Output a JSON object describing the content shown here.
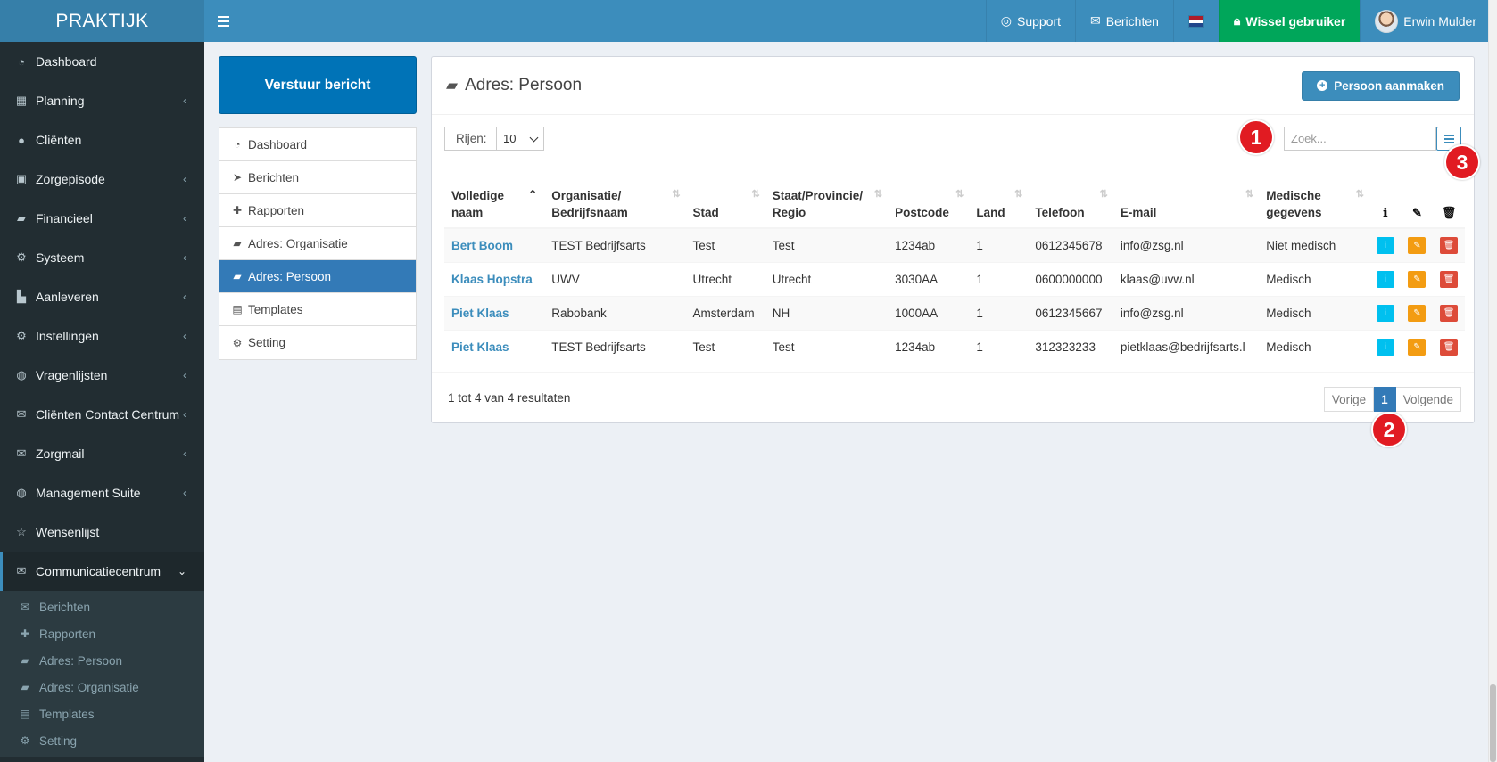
{
  "app": {
    "logo": "PRAKTIJK"
  },
  "header": {
    "support": "Support",
    "messages": "Berichten",
    "switch_user": "Wissel gebruiker",
    "user_name": "Erwin Mulder",
    "flag_colors": [
      "#ae1c28",
      "#ffffff",
      "#21468b"
    ]
  },
  "sidebar": {
    "items": [
      {
        "label": "Dashboard",
        "icon": "dashboard-icon",
        "glyph": "◔"
      },
      {
        "label": "Planning",
        "icon": "calendar-icon",
        "glyph": "▦"
      },
      {
        "label": "Cliënten",
        "icon": "user-icon",
        "glyph": "●"
      },
      {
        "label": "Zorgepisode",
        "icon": "briefcase-icon",
        "glyph": "▣"
      },
      {
        "label": "Financieel",
        "icon": "book-icon",
        "glyph": "▰"
      },
      {
        "label": "Systeem",
        "icon": "cogs-icon",
        "glyph": "⚙"
      },
      {
        "label": "Aanleveren",
        "icon": "truck-icon",
        "glyph": "▙"
      },
      {
        "label": "Instellingen",
        "icon": "gear-icon",
        "glyph": "⚙"
      },
      {
        "label": "Vragenlijsten",
        "icon": "globe-icon",
        "glyph": "◍"
      },
      {
        "label": "Cliënten Contact Centrum",
        "icon": "envelope-icon",
        "glyph": "✉"
      },
      {
        "label": "Zorgmail",
        "icon": "envelope-icon",
        "glyph": "✉"
      },
      {
        "label": "Management Suite",
        "icon": "globe-icon",
        "glyph": "◍"
      },
      {
        "label": "Wensenlijst",
        "icon": "star-icon",
        "glyph": "☆"
      },
      {
        "label": "Communicatiecentrum",
        "icon": "envelope-icon",
        "glyph": "✉"
      }
    ],
    "subitems": [
      {
        "label": "Berichten",
        "icon": "envelope-icon",
        "glyph": "✉"
      },
      {
        "label": "Rapporten",
        "icon": "puzzle-icon",
        "glyph": "✚"
      },
      {
        "label": "Adres: Persoon",
        "icon": "book-icon",
        "glyph": "▰"
      },
      {
        "label": "Adres: Organisatie",
        "icon": "book-icon",
        "glyph": "▰"
      },
      {
        "label": "Templates",
        "icon": "cubes-icon",
        "glyph": "▤"
      },
      {
        "label": "Setting",
        "icon": "cogs-icon",
        "glyph": "⚙"
      }
    ]
  },
  "side_panel": {
    "send_button": "Verstuur bericht",
    "items": [
      {
        "label": "Dashboard",
        "icon": "dashboard-icon",
        "glyph": "◔"
      },
      {
        "label": "Berichten",
        "icon": "paper-plane-icon",
        "glyph": "➤"
      },
      {
        "label": "Rapporten",
        "icon": "puzzle-icon",
        "glyph": "✚"
      },
      {
        "label": "Adres: Organisatie",
        "icon": "book-icon",
        "glyph": "▰"
      },
      {
        "label": "Adres: Persoon",
        "icon": "book-icon",
        "glyph": "▰"
      },
      {
        "label": "Templates",
        "icon": "cubes-icon",
        "glyph": "▤"
      },
      {
        "label": "Setting",
        "icon": "cogs-icon",
        "glyph": "⚙"
      }
    ]
  },
  "content": {
    "title": "Adres: Persoon",
    "create_button": "Persoon aanmaken",
    "rows_label": "Rijen:",
    "rows_value": "10",
    "search_placeholder": "Zoek...",
    "columns": [
      "Volledige naam",
      "Organisatie/ Bedrijfsnaam",
      "Stad",
      "Staat/Provincie/ Regio",
      "Postcode",
      "Land",
      "Telefoon",
      "E-mail",
      "Medische gegevens"
    ],
    "rows": [
      [
        "Bert Boom",
        "TEST Bedrijfsarts",
        "Test",
        "Test",
        "1234ab",
        "1",
        "0612345678",
        "info@zsg.nl",
        "Niet medisch"
      ],
      [
        "Klaas Hopstra",
        "UWV",
        "Utrecht",
        "Utrecht",
        "3030AA",
        "1",
        "0600000000",
        "klaas@uvw.nl",
        "Medisch"
      ],
      [
        "Piet Klaas",
        "Rabobank",
        "Amsterdam",
        "NH",
        "1000AA",
        "1",
        "0612345667",
        "info@zsg.nl",
        "Medisch"
      ],
      [
        "Piet Klaas",
        "TEST Bedrijfsarts",
        "Test",
        "Test",
        "1234ab",
        "1",
        "312323233",
        "pietklaas@bedrijfsarts.l",
        "Medisch"
      ]
    ],
    "results_text": "1 tot 4 van 4 resultaten",
    "pagination": {
      "prev": "Vorige",
      "current": "1",
      "next": "Volgende"
    }
  },
  "annotations": [
    "1",
    "2",
    "3"
  ],
  "colors": {
    "header": "#3c8dbc",
    "sidebar": "#222d32",
    "success": "#00a65a",
    "marker": "#e11b22"
  }
}
